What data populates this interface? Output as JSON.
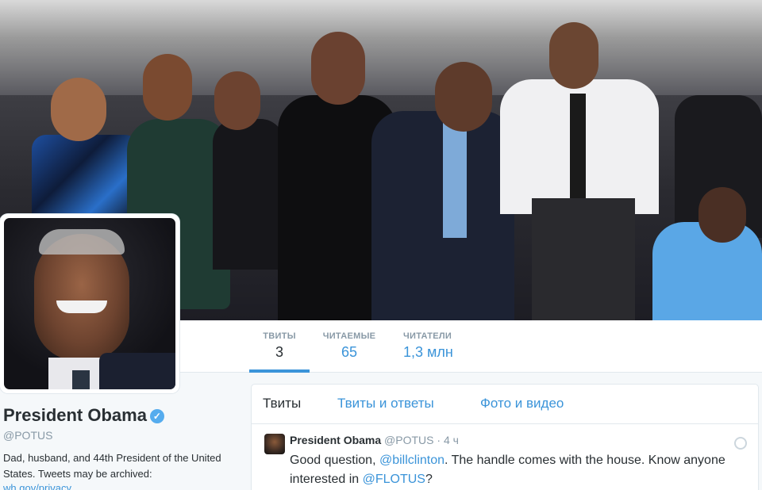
{
  "stats": {
    "tweets": {
      "label": "ТВИТЫ",
      "value": "3"
    },
    "following": {
      "label": "ЧИТАЕМЫЕ",
      "value": "65"
    },
    "followers": {
      "label": "ЧИТАТЕЛИ",
      "value": "1,3 млн"
    }
  },
  "profile": {
    "name": "President Obama",
    "handle": "@POTUS",
    "bio": "Dad, husband, and 44th President of the United States. Tweets may be archived:",
    "link": "wh.gov/privacy"
  },
  "tabs": [
    "Твиты",
    "Твиты и ответы",
    "Фото и видео"
  ],
  "tweet": {
    "name": "President Obama",
    "handle": "@POTUS",
    "separator": "·",
    "time": "4 ч",
    "text_1": "Good question, ",
    "mention_1": "@billclinton",
    "text_2": ". The handle comes with the house. Know anyone interested in ",
    "mention_2": "@FLOTUS",
    "text_3": "?"
  },
  "icons": {
    "verified": "verified-badge-icon",
    "tweet_caret": "tweet-options-icon"
  },
  "colors": {
    "accent": "#3b94d9",
    "verified": "#55acee",
    "muted": "#8899a6"
  }
}
